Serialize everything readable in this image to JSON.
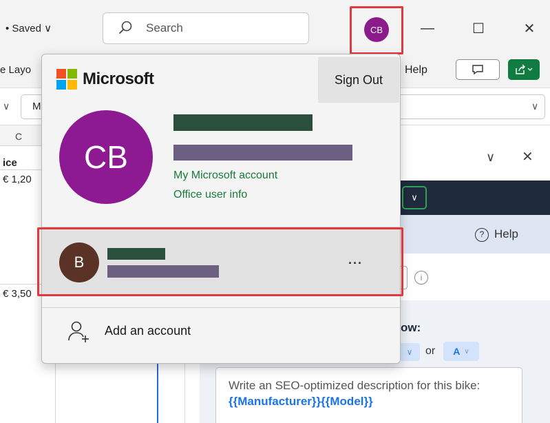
{
  "titlebar": {
    "saved_label": "• Saved ∨",
    "search_placeholder": "Search",
    "avatar_initials": "CB",
    "minimize": "—",
    "maximize": "☐",
    "close": "✕"
  },
  "ribbon": {
    "layout_fragment": "e Layo",
    "help_label": "Help"
  },
  "formula_bar": {
    "namebox_value": "M",
    "left_caret": "∨",
    "right_caret": "∨"
  },
  "sheet": {
    "column_letter": "C",
    "header_cell": "ice",
    "value_1": "€ 1,20",
    "value_2": "€ 3,50"
  },
  "side_pane": {
    "collapse": "∨",
    "close": "✕",
    "dropdown": "∨",
    "help_label": "Help",
    "info_icon": "i",
    "heading_fragment": "ow:",
    "or_label": "or",
    "chip_a": "A",
    "chip_caret": "∨",
    "prompt_text": "Write an SEO-optimized description for this bike:",
    "prompt_var_1": "{{Manufacturer}}",
    "prompt_var_2": "{{Model}}"
  },
  "account_popup": {
    "brand": "Microsoft",
    "sign_out": "Sign Out",
    "avatar_initials": "CB",
    "link_account": "My Microsoft account",
    "link_office": "Office user info",
    "other_account_initial": "B",
    "more": "···",
    "add_account": "Add an account"
  },
  "colors": {
    "accent_green": "#107c41",
    "link_green": "#177b3a",
    "avatar_purple": "#8e1a93",
    "highlight_red": "#e0393e",
    "redact_green": "#2a4f3c",
    "redact_purple": "#6d5f82"
  }
}
